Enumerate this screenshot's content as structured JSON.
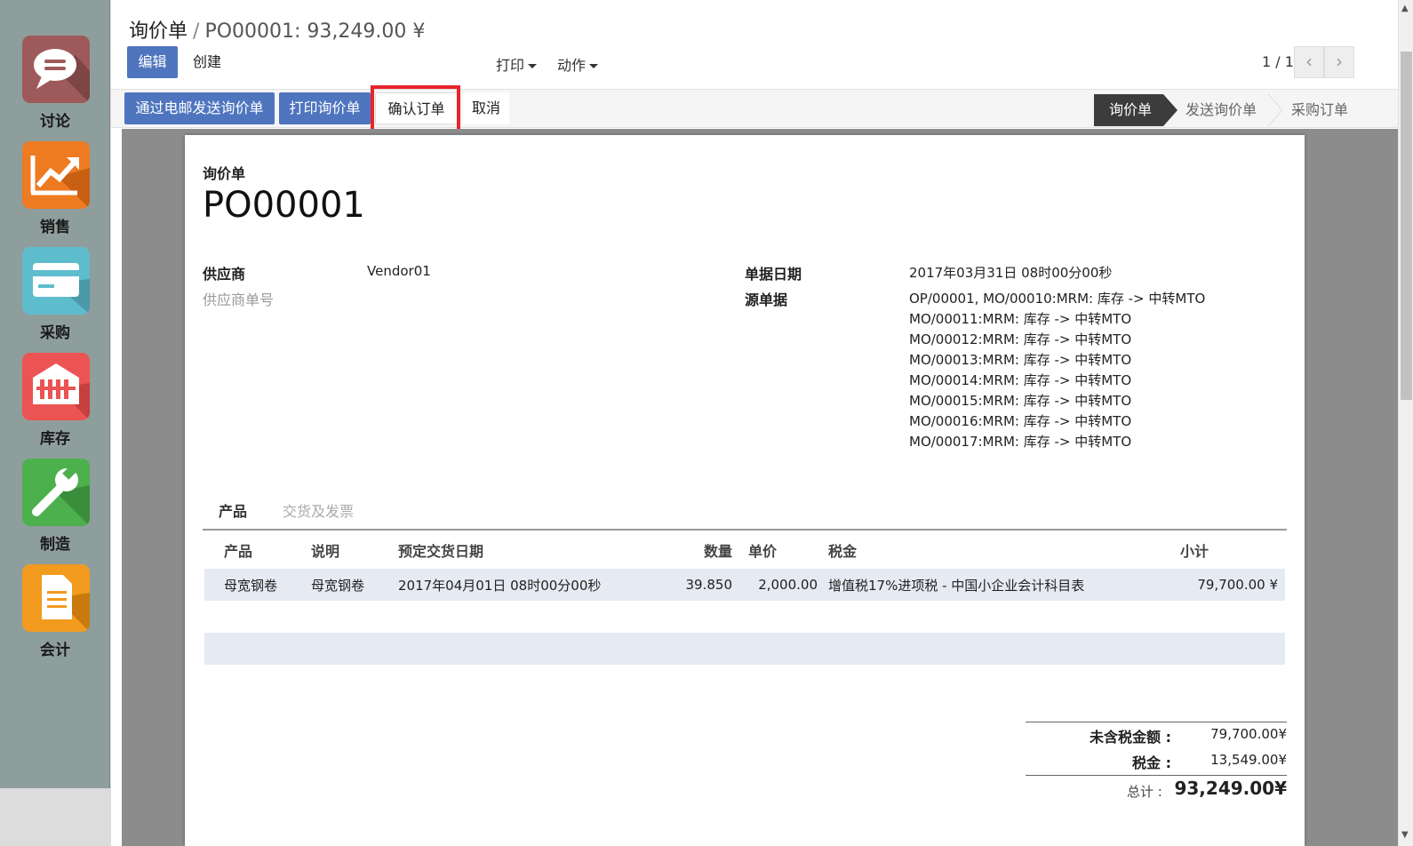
{
  "sidebar": {
    "apps": [
      {
        "label": "讨论",
        "icon": "chat-icon",
        "color": "#bf3a3a"
      },
      {
        "label": "销售",
        "icon": "trending-up-icon",
        "color": "#f07a1a"
      },
      {
        "label": "采购",
        "icon": "credit-card-icon",
        "color": "#5cb8c8"
      },
      {
        "label": "库存",
        "icon": "warehouse-icon",
        "color": "#e84a4a"
      },
      {
        "label": "制造",
        "icon": "wrench-icon",
        "color": "#4caf50"
      },
      {
        "label": "会计",
        "icon": "document-icon",
        "color": "#f4a31c"
      }
    ]
  },
  "breadcrumb": {
    "root": "询价单",
    "separator": "/",
    "current": "PO00001: 93,249.00 ¥"
  },
  "toolbar": {
    "edit": "编辑",
    "create": "创建",
    "print": "打印",
    "action": "动作"
  },
  "pager": {
    "value": "1 / 1"
  },
  "actions": {
    "send_email": "通过电邮发送询价单",
    "print_rfq": "打印询价单",
    "confirm": "确认订单",
    "cancel": "取消"
  },
  "stages": {
    "rfq": "询价单",
    "rfq_sent": "发送询价单",
    "purchase_order": "采购订单"
  },
  "form": {
    "doc_type": "询价单",
    "name": "PO00001",
    "vendor_label": "供应商",
    "vendor_value": "Vendor01",
    "vendor_ref_label": "供应商单号",
    "date_label": "单据日期",
    "date_value": "2017年03月31日 08时00分00秒",
    "origin_label": "源单据",
    "origin_lines": [
      "OP/00001, MO/00010:MRM: 库存 -> 中转MTO",
      "MO/00011:MRM: 库存 -> 中转MTO",
      "MO/00012:MRM: 库存 -> 中转MTO",
      "MO/00013:MRM: 库存 -> 中转MTO",
      "MO/00014:MRM: 库存 -> 中转MTO",
      "MO/00015:MRM: 库存 -> 中转MTO",
      "MO/00016:MRM: 库存 -> 中转MTO",
      "MO/00017:MRM: 库存 -> 中转MTO"
    ]
  },
  "tabs": {
    "products": "产品",
    "delivery": "交货及发票"
  },
  "lines": {
    "headers": {
      "product": "产品",
      "description": "说明",
      "date": "预定交货日期",
      "qty": "数量",
      "price": "单价",
      "taxes": "税金",
      "subtotal": "小计"
    },
    "rows": [
      {
        "product": "母宽钢卷",
        "description": "母宽钢卷",
        "date": "2017年04月01日 08时00分00秒",
        "qty": "39.850",
        "price": "2,000.00",
        "taxes": "增值税17%进项税 - 中国小企业会计科目表",
        "subtotal": "79,700.00 ¥"
      }
    ]
  },
  "totals": {
    "untaxed_label": "未含税金额 :",
    "untaxed_value": "79,700.00¥",
    "tax_label": "税金 :",
    "tax_value": "13,549.00¥",
    "total_label": "总计 :",
    "total_value": "93,249.00¥"
  }
}
